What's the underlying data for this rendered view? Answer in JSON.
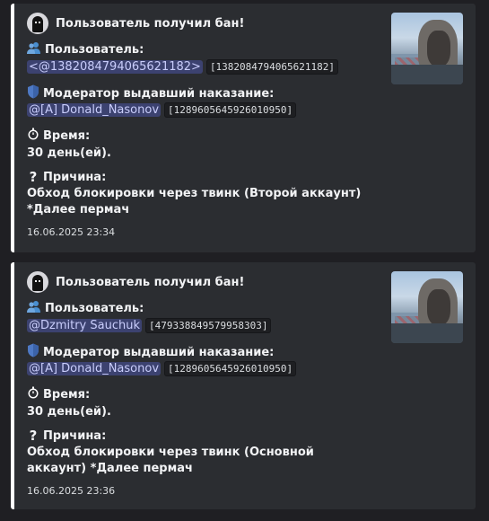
{
  "embeds": [
    {
      "author": "Пользователь получил бан!",
      "user_label": "Пользователь:",
      "user_mention": "<@1382084794065621182>",
      "user_id": "[1382084794065621182]",
      "moderator_label": "Модератор выдавший наказание:",
      "moderator_mention": "@[A] Donald_Nasonov",
      "moderator_id": "[1289605645926010950]",
      "time_label": "Время:",
      "time_value": "30 день(ей).",
      "reason_label": "Причина:",
      "reason_value": "Обход блокировки через твинк (Второй аккаунт) *Далее пермач",
      "timestamp": "16.06.2025 23:34"
    },
    {
      "author": "Пользователь получил бан!",
      "user_label": "Пользователь:",
      "user_mention": "@Dzmitry Sauchuk",
      "user_id": "[479338849579958303]",
      "moderator_label": "Модератор выдавший наказание:",
      "moderator_mention": "@[A] Donald_Nasonov",
      "moderator_id": "[1289605645926010950]",
      "time_label": "Время:",
      "time_value": "30 день(ей).",
      "reason_label": "Причина:",
      "reason_value": "Обход блокировки через твинк (Основной аккаунт) *Далее пермач",
      "timestamp": "16.06.2025 23:36"
    }
  ],
  "icons": {
    "users": "busts-in-silhouette-icon",
    "shield": "shield-icon",
    "time": "stopwatch-icon",
    "reason": "question-mark-icon"
  },
  "colors": {
    "embed_border": "#ffffff",
    "embed_bg": "#2b2d31",
    "mention_bg": "#3c4270",
    "mention_text": "#c9cdfb"
  }
}
